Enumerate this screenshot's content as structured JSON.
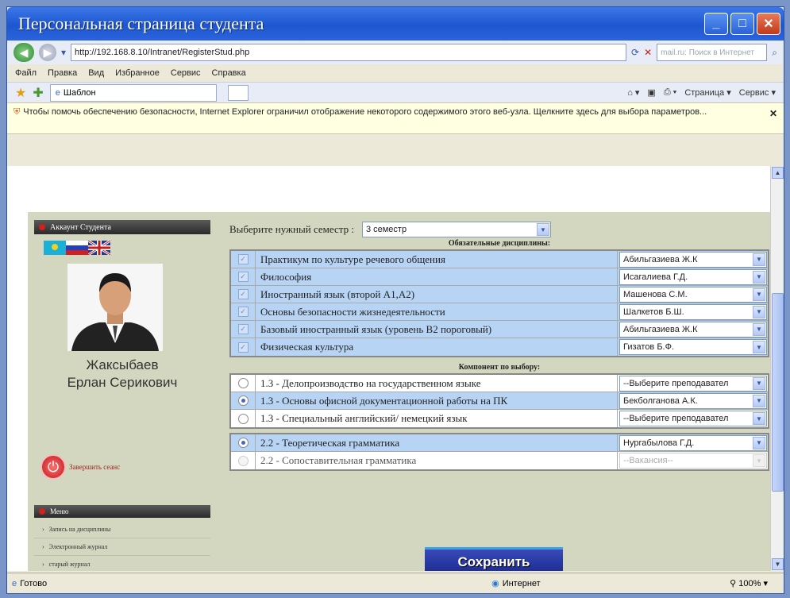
{
  "window": {
    "title": "Персональная страница студента"
  },
  "browser": {
    "url": "http://192.168.8.10/Intranet/RegisterStud.php",
    "search_placeholder": "mail.ru: Поиск в Интернет",
    "menu": [
      "Файл",
      "Правка",
      "Вид",
      "Избранное",
      "Сервис",
      "Справка"
    ],
    "tab_label": "Шаблон",
    "page_menu": "Страница",
    "tools_menu": "Сервис",
    "infobar": "Чтобы помочь обеспечению безопасности, Internet Explorer ограничил отображение некоторого содержимого этого веб-узла. Щелкните здесь для выбора параметров...",
    "status": "Готово",
    "zone": "Интернет",
    "zoom": "100%"
  },
  "sidebar": {
    "account_header": "Аккаунт Студента",
    "student_name_line1": "Жаксыбаев",
    "student_name_line2": "Ерлан Серикович",
    "logout": "Завершить сеанс",
    "menu_header": "Меню",
    "menu_items": [
      "Запись на дисциплины",
      "Электронный журнал",
      "старый журнал"
    ]
  },
  "form": {
    "semester_label": "Выберите нужный семестр :",
    "semester_value": "3 семестр",
    "required_title": "Обязательные дисциплины:",
    "required": [
      {
        "name": "Практикум по культуре речевого общения",
        "teacher": "Абильгазиева Ж.К"
      },
      {
        "name": "Философия",
        "teacher": "Исагалиева Г.Д."
      },
      {
        "name": "Иностранный язык (второй А1,А2)",
        "teacher": "Машенова С.М."
      },
      {
        "name": "Основы безопасности жизнедеятельности",
        "teacher": "Шалкетов Б.Ш."
      },
      {
        "name": "Базовый иностранный язык (уровень В2 пороговый)",
        "teacher": "Абильгазиева Ж.К"
      },
      {
        "name": "Физическая культура",
        "teacher": "Гизатов Б.Ф."
      }
    ],
    "elective_title": "Компонент по выбору:",
    "elective_group1": [
      {
        "name": "1.3 - Делопроизводство на государственном языке",
        "teacher": "--Выберите преподавател",
        "selected": false
      },
      {
        "name": "1.3 - Основы офисной документационной работы на ПК",
        "teacher": "Бекболганова А.К.",
        "selected": true
      },
      {
        "name": "1.3 - Специальный английский/ немецкий язык",
        "teacher": "--Выберите преподавател",
        "selected": false
      }
    ],
    "elective_group2": [
      {
        "name": "2.2 - Теоретическая грамматика",
        "teacher": "Нургабылова Г.Д.",
        "selected": true
      },
      {
        "name": "2.2 - Сопоставительная грамматика",
        "teacher": "--Вакансия--",
        "selected": false
      }
    ],
    "save_label": "Сохранить"
  }
}
